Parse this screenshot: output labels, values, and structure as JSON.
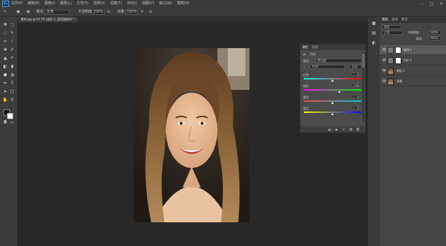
{
  "app": {
    "logo": "Ps"
  },
  "menu": [
    "文件(F)",
    "编辑(E)",
    "图像(I)",
    "图层(L)",
    "文字(Y)",
    "选择(S)",
    "滤镜(T)",
    "3D(D)",
    "视图(V)",
    "窗口(W)",
    "帮助(H)"
  ],
  "window_controls": [
    "–",
    "□",
    "✕"
  ],
  "options": {
    "mode_label": "模式:",
    "mode_value": "正常",
    "opacity_label": "不透明度:",
    "opacity_value": "100%",
    "flow_label": "流量:",
    "flow_value": "100%"
  },
  "document": {
    "tab_title": "素材.jpg @ 66.7% (曲线 1, 蓝色通道/8) *"
  },
  "tools": [
    "move-icon",
    "marquee-icon",
    "lasso-icon",
    "quick-select-icon",
    "crop-icon",
    "eyedropper-icon",
    "healing-icon",
    "brush-icon",
    "stamp-icon",
    "history-brush-icon",
    "eraser-icon",
    "gradient-icon",
    "blur-icon",
    "dodge-icon",
    "pen-icon",
    "type-icon",
    "path-select-icon",
    "shape-icon",
    "hand-icon",
    "zoom-icon"
  ],
  "colors": {
    "foreground": "#111111",
    "background": "#ffffff",
    "accent": "#4aa8ff"
  },
  "properties": {
    "tabs": [
      "属性",
      "信息"
    ],
    "title": "色阶",
    "preset_label": "预设:",
    "preset_value": "默认值",
    "channel_value": "RGB",
    "auto_label": "自动",
    "sliders": [
      {
        "label": "红色",
        "value": "0"
      },
      {
        "label": "绿色",
        "value": "138"
      },
      {
        "label": "青色",
        "value": "0"
      },
      {
        "label": "蓝色",
        "value": "0"
      }
    ]
  },
  "layers": {
    "tabs": [
      "图层",
      "通道",
      "路径"
    ],
    "kind_label": "类型",
    "blend_label": "正常",
    "opacity_label": "不透明度:",
    "opacity_value": "100%",
    "fill_label": "填充:",
    "fill_value": "100%",
    "items": [
      {
        "name": "曲线 1",
        "selected": true,
        "has_mask": true
      },
      {
        "name": "色阶 1",
        "selected": false,
        "has_mask": true
      },
      {
        "name": "图层 1",
        "selected": false,
        "has_mask": false
      },
      {
        "name": "背景",
        "selected": false,
        "has_mask": false
      }
    ]
  }
}
